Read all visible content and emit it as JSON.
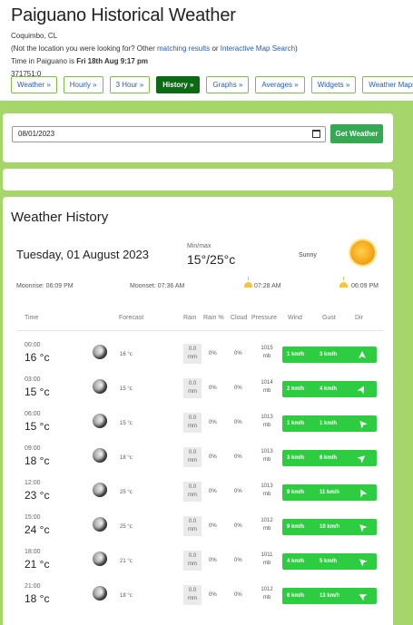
{
  "header": {
    "title": "Paiguano Historical Weather",
    "location": "Coquimbo, CL",
    "not_location_prefix": "(Not the location you were looking for? Other ",
    "matching_results": "matching results",
    "or_text": " or ",
    "map_search": "Interactive Map Search",
    "not_location_suffix": ")",
    "time_prefix": "Time in Paiguano is ",
    "time_value": "Fri 18th Aug 9:17 pm",
    "code": "371751:0"
  },
  "nav": [
    "Weather »",
    "Hourly »",
    "3 Hour »",
    "History »",
    "Graphs »",
    "Averages »",
    "Widgets »",
    "Weather Maps"
  ],
  "date_form": {
    "date_value": "08/01/2023",
    "button": "Get Weather"
  },
  "history": {
    "heading": "Weather History",
    "day": "Tuesday, 01 August 2023",
    "minmax_label": "Min/max",
    "minmax": "15°/25°c",
    "condition": "Sunny",
    "moonrise": "Moonrise: 06:09 PM",
    "moonset": "Moonset: 07:36 AM",
    "sunrise": "07:28 AM",
    "sunset": "06:09 PM",
    "columns": [
      "Time",
      "Forecast",
      "Rain",
      "Rain %",
      "Cloud",
      "Pressure",
      "Wind",
      "Gust",
      "Dir"
    ],
    "rows": [
      {
        "time": "00:00",
        "temp": "16 °c",
        "forecast": "16 °c",
        "rain": "0.0",
        "rain_unit": "mm",
        "rain_pct": "0%",
        "cloud": "0%",
        "pressure": "1015",
        "pressure_unit": "mb",
        "wind": "1 km/h",
        "gust": "3 km/h",
        "dir_deg": 0
      },
      {
        "time": "03:00",
        "temp": "15 °c",
        "forecast": "15 °c",
        "rain": "0.0",
        "rain_unit": "mm",
        "rain_pct": "0%",
        "cloud": "0%",
        "pressure": "1014",
        "pressure_unit": "mb",
        "wind": "2 km/h",
        "gust": "4 km/h",
        "dir_deg": 30
      },
      {
        "time": "06:00",
        "temp": "15 °c",
        "forecast": "15 °c",
        "rain": "0.0",
        "rain_unit": "mm",
        "rain_pct": "0%",
        "cloud": "0%",
        "pressure": "1013",
        "pressure_unit": "mb",
        "wind": "1 km/h",
        "gust": "1 km/h",
        "dir_deg": 320
      },
      {
        "time": "09:00",
        "temp": "18 °c",
        "forecast": "18 °c",
        "rain": "0.0",
        "rain_unit": "mm",
        "rain_pct": "0%",
        "cloud": "0%",
        "pressure": "1013",
        "pressure_unit": "mb",
        "wind": "3 km/h",
        "gust": "6 km/h",
        "dir_deg": 50
      },
      {
        "time": "12:00",
        "temp": "23 °c",
        "forecast": "25 °c",
        "rain": "0.0",
        "rain_unit": "mm",
        "rain_pct": "0%",
        "cloud": "0%",
        "pressure": "1013",
        "pressure_unit": "mb",
        "wind": "9 km/h",
        "gust": "11 km/h",
        "dir_deg": 330
      },
      {
        "time": "15:00",
        "temp": "24 °c",
        "forecast": "25 °c",
        "rain": "0.0",
        "rain_unit": "mm",
        "rain_pct": "0%",
        "cloud": "0%",
        "pressure": "1012",
        "pressure_unit": "mb",
        "wind": "9 km/h",
        "gust": "10 km/h",
        "dir_deg": 315
      },
      {
        "time": "18:00",
        "temp": "21 °c",
        "forecast": "21 °c",
        "rain": "0.0",
        "rain_unit": "mm",
        "rain_pct": "0%",
        "cloud": "0%",
        "pressure": "1011",
        "pressure_unit": "mb",
        "wind": "4 km/h",
        "gust": "5 km/h",
        "dir_deg": 310
      },
      {
        "time": "21:00",
        "temp": "18 °c",
        "forecast": "18 °c",
        "rain": "0.0",
        "rain_unit": "mm",
        "rain_pct": "0%",
        "cloud": "0%",
        "pressure": "1012",
        "pressure_unit": "mb",
        "wind": "6 km/h",
        "gust": "13 km/h",
        "dir_deg": 300
      }
    ]
  },
  "colors": {
    "accent_green": "#2ecc40",
    "active_nav": "#0b6b12",
    "background": "#a6d66a",
    "link": "#2a5db0"
  }
}
